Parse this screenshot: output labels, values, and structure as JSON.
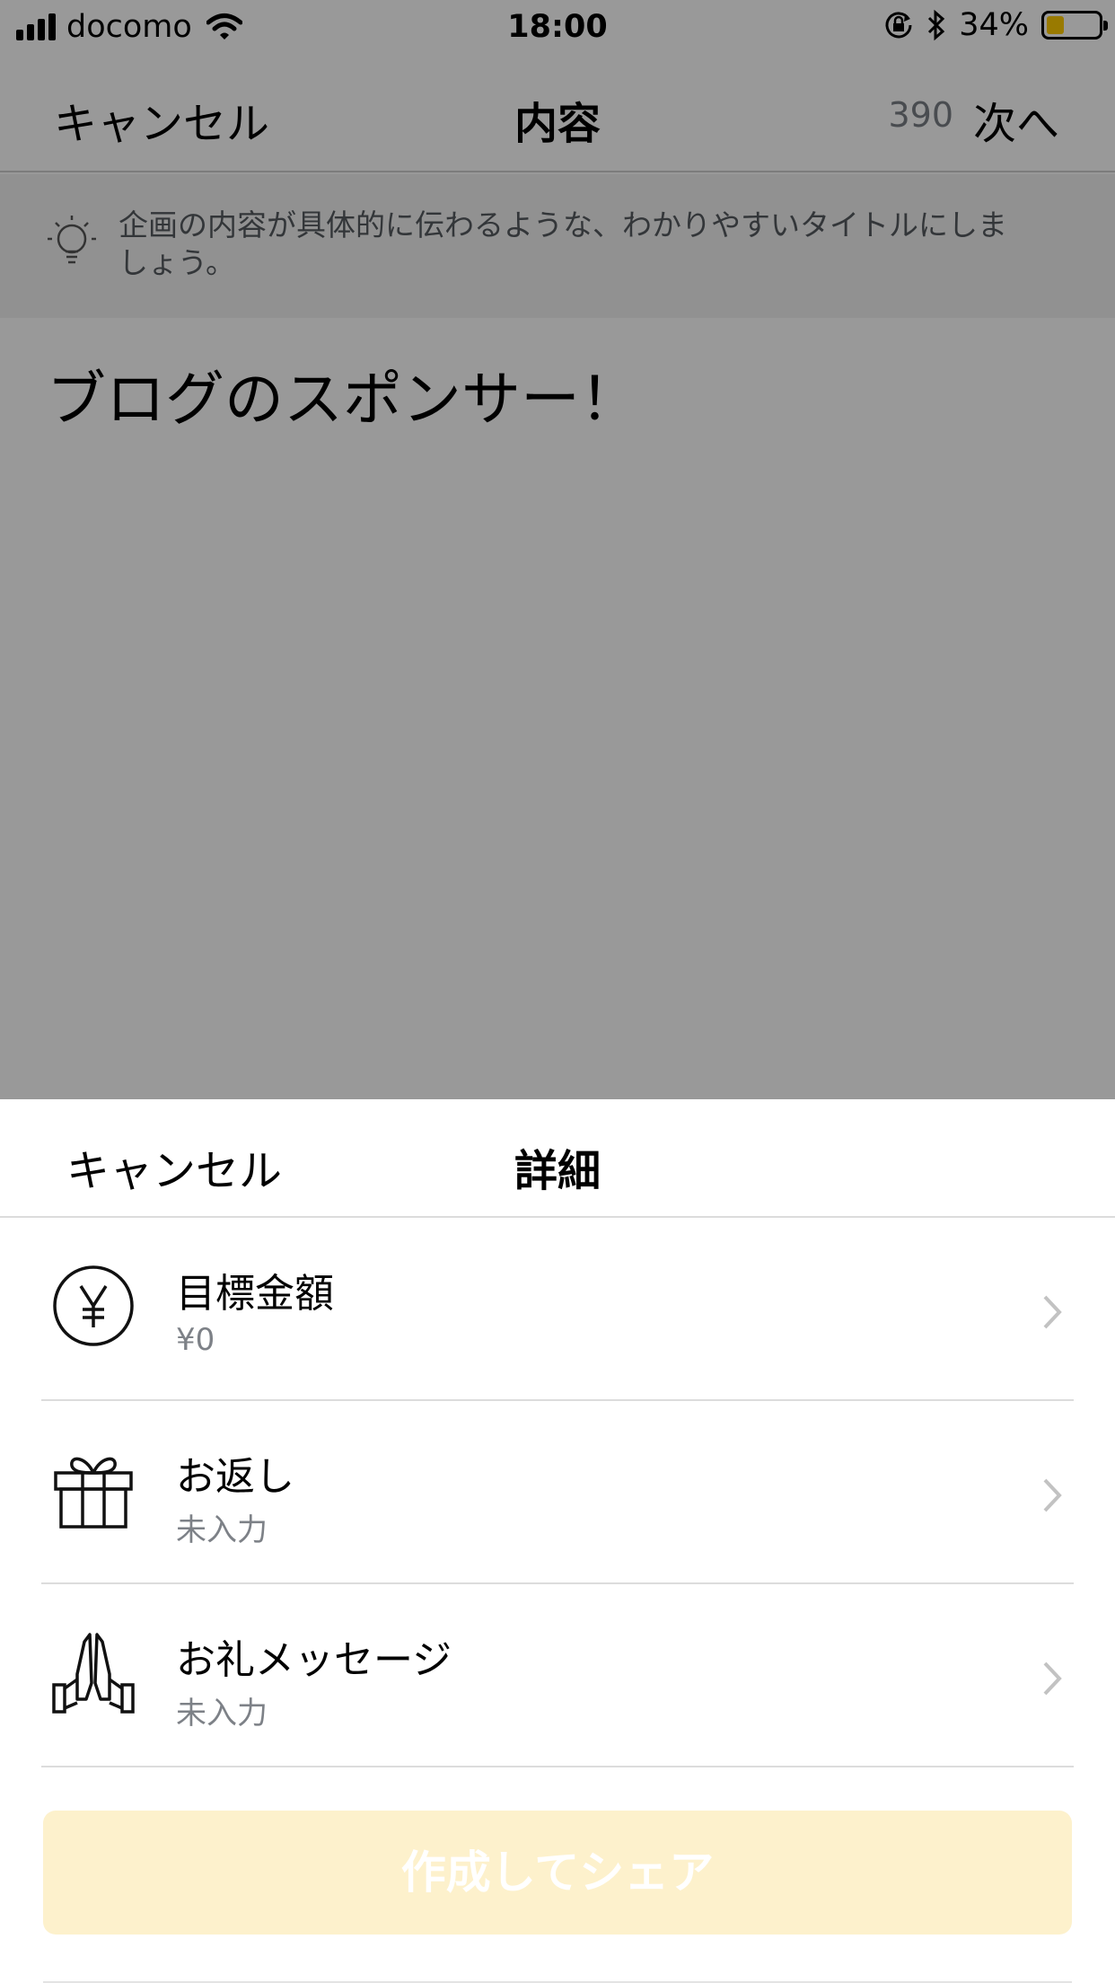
{
  "status_bar": {
    "carrier": "docomo",
    "time": "18:00",
    "battery_percent": "34%",
    "battery_level": 0.34,
    "battery_color": "#ffcc00"
  },
  "nav": {
    "cancel_label": "キャンセル",
    "title": "内容",
    "char_count": "390",
    "next_label": "次へ"
  },
  "tip": {
    "icon": "lightbulb-icon",
    "text": "企画の内容が具体的に伝わるような、わかりやすいタイトルにしましょう。"
  },
  "content": {
    "title_value": "ブログのスポンサー！"
  },
  "sheet": {
    "cancel_label": "キャンセル",
    "title": "詳細",
    "items": [
      {
        "icon": "yen-icon",
        "label": "目標金額",
        "value": "¥0"
      },
      {
        "icon": "gift-icon",
        "label": "お返し",
        "value": "未入力"
      },
      {
        "icon": "praying-hands-icon",
        "label": "お礼メッセージ",
        "value": "未入力"
      }
    ],
    "create_label": "作成してシェア",
    "create_color": "#fdf1cc"
  }
}
